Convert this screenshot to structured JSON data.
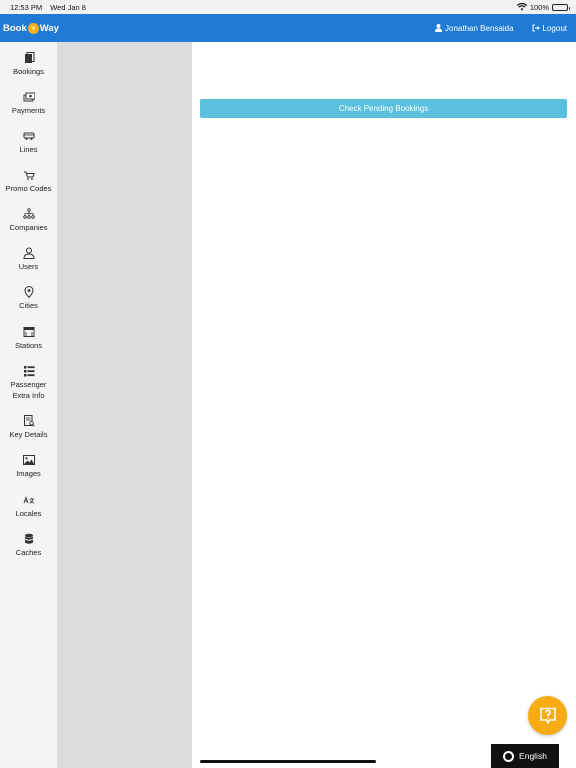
{
  "status_bar": {
    "time": "12:53 PM",
    "date": "Wed Jan 8",
    "battery": "100%"
  },
  "navbar": {
    "brand_left": "Book",
    "brand_logo_char": "☀",
    "brand_right": "Way",
    "user": "Jonathan Bensaida",
    "logout": "Logout",
    "color": "#1f7bd6"
  },
  "sidebar": {
    "items": [
      {
        "label": "Bookings",
        "icon": "bookings-icon"
      },
      {
        "label": "Payments",
        "icon": "payments-icon"
      },
      {
        "label": "Lines",
        "icon": "bus-icon"
      },
      {
        "label": "Promo Codes",
        "icon": "cart-icon"
      },
      {
        "label": "Companies",
        "icon": "sitemap-icon"
      },
      {
        "label": "Users",
        "icon": "user-icon"
      },
      {
        "label": "Cities",
        "icon": "map-pin-icon"
      },
      {
        "label": "Stations",
        "icon": "station-icon"
      },
      {
        "label": "Passenger\nExtra Info",
        "label_line1": "Passenger",
        "label_line2": "Extra Info",
        "icon": "list-icon"
      },
      {
        "label": "Key Details",
        "icon": "document-search-icon"
      },
      {
        "label": "Images",
        "icon": "image-icon"
      },
      {
        "label": "Locales",
        "icon": "translate-icon"
      },
      {
        "label": "Caches",
        "icon": "database-icon"
      }
    ]
  },
  "main": {
    "check_pending_label": "Check Pending Bookings",
    "button_color": "#5bc0de"
  },
  "help": {
    "icon": "question-bubble-icon",
    "color": "#f6ac12"
  },
  "language": {
    "label": "English"
  }
}
